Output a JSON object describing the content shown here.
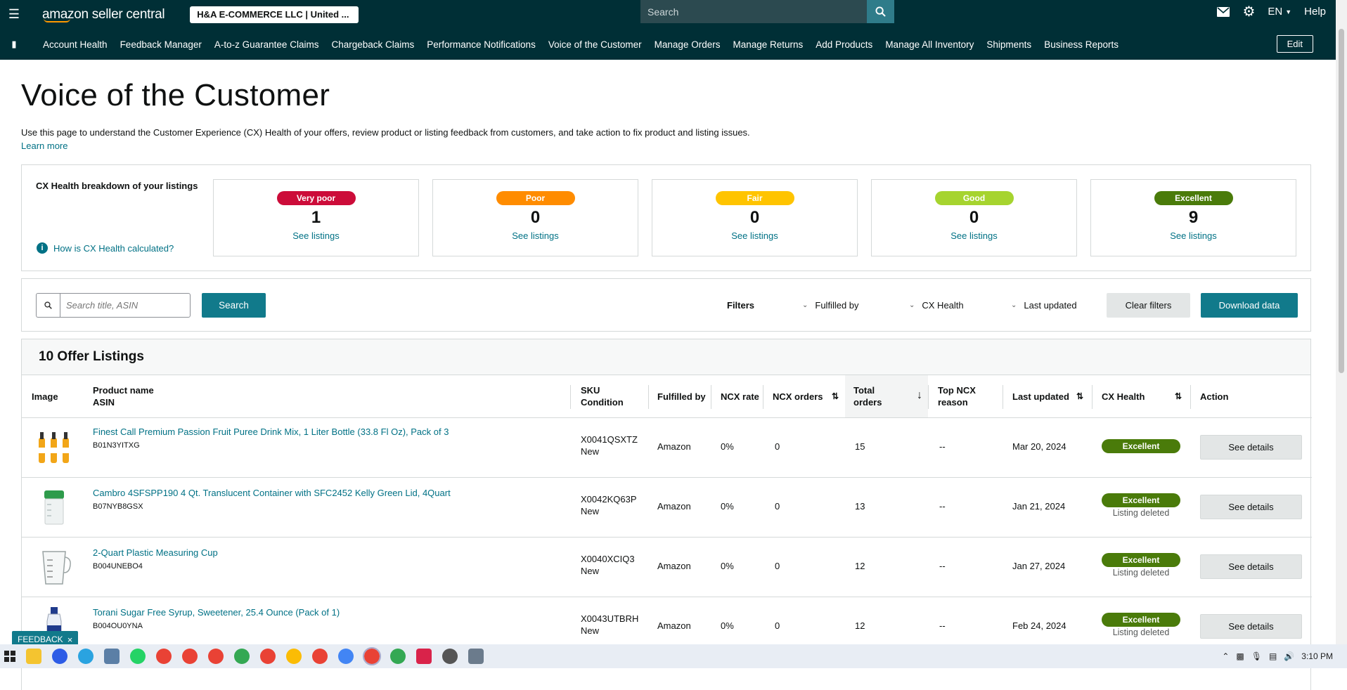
{
  "topbar": {
    "logo_text": "amazon seller central",
    "account": "H&A E-COMMERCE LLC | United ...",
    "search_placeholder": "Search",
    "lang": "EN",
    "help": "Help"
  },
  "nav": {
    "items": [
      "Account Health",
      "Feedback Manager",
      "A-to-z Guarantee Claims",
      "Chargeback Claims",
      "Performance Notifications",
      "Voice of the Customer",
      "Manage Orders",
      "Manage Returns",
      "Add Products",
      "Manage All Inventory",
      "Shipments",
      "Business Reports"
    ],
    "edit": "Edit"
  },
  "page": {
    "title": "Voice of the Customer",
    "intro": "Use this page to understand the Customer Experience (CX) Health of your offers, review product or listing feedback from customers, and take action to fix product and listing issues.",
    "learn_more": "Learn more"
  },
  "health": {
    "title": "CX Health breakdown of your listings",
    "how_link": "How is CX Health calculated?",
    "tiles": [
      {
        "label": "Very poor",
        "count": "1",
        "link": "See listings",
        "color": "#cc0c39"
      },
      {
        "label": "Poor",
        "count": "0",
        "link": "See listings",
        "color": "#ff8c00"
      },
      {
        "label": "Fair",
        "count": "0",
        "link": "See listings",
        "color": "#ffc400"
      },
      {
        "label": "Good",
        "count": "0",
        "link": "See listings",
        "color": "#a6d42f"
      },
      {
        "label": "Excellent",
        "count": "9",
        "link": "See listings",
        "color": "#4a7b0a"
      }
    ]
  },
  "filters": {
    "search_placeholder": "Search title, ASIN",
    "search_btn": "Search",
    "label": "Filters",
    "fulfilled_by": "Fulfilled by",
    "cx_health": "CX Health",
    "last_updated": "Last updated",
    "clear": "Clear filters",
    "download": "Download data"
  },
  "listings": {
    "title": "10 Offer Listings",
    "headers": {
      "image": "Image",
      "product": "Product name",
      "asin": "ASIN",
      "sku": "SKU",
      "condition": "Condition",
      "fulfilled": "Fulfilled by",
      "ncx_rate": "NCX rate",
      "ncx_orders": "NCX orders",
      "total": "Total",
      "orders": "orders",
      "top_ncx": "Top NCX",
      "reason": "reason",
      "last_updated": "Last updated",
      "cx_health": "CX Health",
      "action": "Action"
    },
    "rows": [
      {
        "name": "Finest Call Premium Passion Fruit Puree Drink Mix, 1 Liter Bottle (33.8 Fl Oz), Pack of 3",
        "asin": "B01N3YITXG",
        "sku": "X0041QSXTZ",
        "condition": "New",
        "fulfilled": "Amazon",
        "ncx_rate": "0%",
        "ncx_orders": "0",
        "total": "15",
        "reason": "--",
        "updated": "Mar 20, 2024",
        "health": "Excellent",
        "status": "",
        "action": "See details"
      },
      {
        "name": "Cambro 4SFSPP190 4 Qt. Translucent Container with SFC2452 Kelly Green Lid, 4Quart",
        "asin": "B07NYB8GSX",
        "sku": "X0042KQ63P",
        "condition": "New",
        "fulfilled": "Amazon",
        "ncx_rate": "0%",
        "ncx_orders": "0",
        "total": "13",
        "reason": "--",
        "updated": "Jan 21, 2024",
        "health": "Excellent",
        "status": "Listing deleted",
        "action": "See details"
      },
      {
        "name": "2-Quart Plastic Measuring Cup",
        "asin": "B004UNEBO4",
        "sku": "X0040XCIQ3",
        "condition": "New",
        "fulfilled": "Amazon",
        "ncx_rate": "0%",
        "ncx_orders": "0",
        "total": "12",
        "reason": "--",
        "updated": "Jan 27, 2024",
        "health": "Excellent",
        "status": "Listing deleted",
        "action": "See details"
      },
      {
        "name": "Torani Sugar Free Syrup, Sweetener, 25.4 Ounce (Pack of 1)",
        "asin": "B004OU0YNA",
        "sku": "X0043UTBRH",
        "condition": "New",
        "fulfilled": "Amazon",
        "ncx_rate": "0%",
        "ncx_orders": "0",
        "total": "12",
        "reason": "--",
        "updated": "Feb 24, 2024",
        "health": "Excellent",
        "status": "Listing deleted",
        "action": "See details"
      }
    ]
  },
  "feedback": "FEEDBACK",
  "taskbar": {
    "time": "3:10 PM"
  }
}
